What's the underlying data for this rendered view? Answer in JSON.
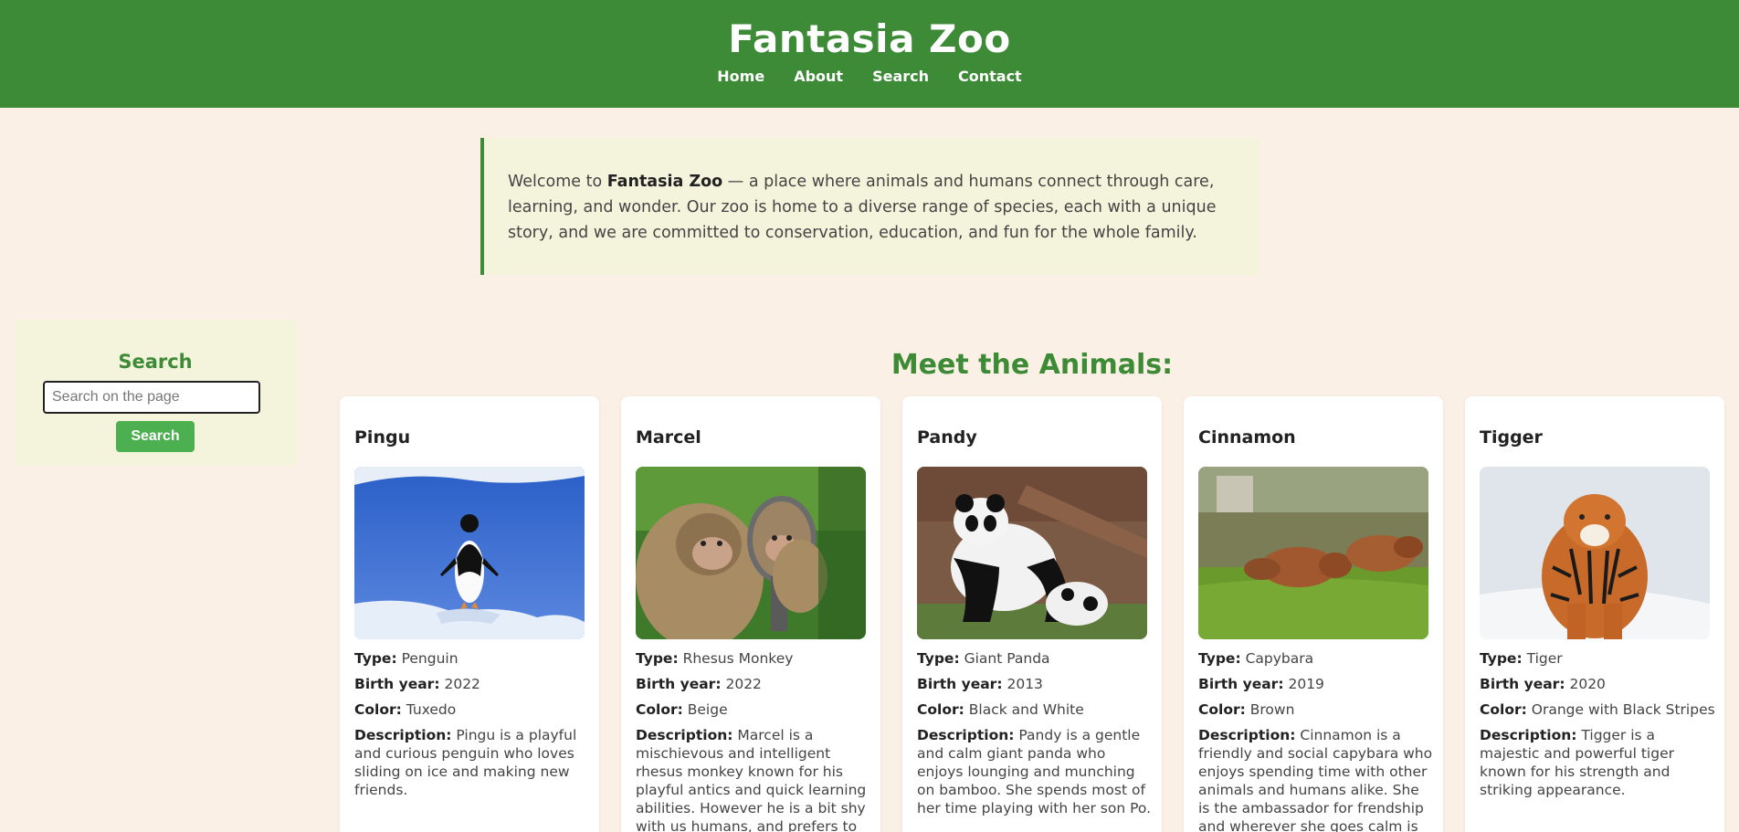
{
  "header": {
    "title": "Fantasia Zoo",
    "nav": [
      "Home",
      "About",
      "Search",
      "Contact"
    ]
  },
  "intro": {
    "lead": "Welcome to ",
    "bold": "Fantasia Zoo",
    "rest": " — a place where animals and humans connect through care, learning, and wonder. Our zoo is home to a diverse range of species, each with a unique story, and we are committed to conservation, education, and fun for the whole family."
  },
  "search": {
    "title": "Search",
    "placeholder": "Search on the page",
    "button": "Search"
  },
  "section_title": "Meet the Animals:",
  "labels": {
    "type": "Type:",
    "birth": "Birth year:",
    "color": "Color:",
    "description": "Description:"
  },
  "animals": [
    {
      "name": "Pingu",
      "type": "Penguin",
      "birth_year": "2022",
      "color": "Tuxedo",
      "description": "Pingu is a playful and curious penguin who loves sliding on ice and making new friends.",
      "image_icon": "penguin-photo"
    },
    {
      "name": "Marcel",
      "type": "Rhesus Monkey",
      "birth_year": "2022",
      "color": "Beige",
      "description": "Marcel is a mischievous and intelligent rhesus monkey known for his playful antics and quick learning abilities. However he is a bit shy with us humans, and prefers to look at us",
      "image_icon": "monkey-photo"
    },
    {
      "name": "Pandy",
      "type": "Giant Panda",
      "birth_year": "2013",
      "color": "Black and White",
      "description": "Pandy is a gentle and calm giant panda who enjoys lounging and munching on bamboo. She spends most of her time playing with her son Po.",
      "image_icon": "panda-photo"
    },
    {
      "name": "Cinnamon",
      "type": "Capybara",
      "birth_year": "2019",
      "color": "Brown",
      "description": "Cinnamon is a friendly and social capybara who enjoys spending time with other animals and humans alike. She is the ambassador for frendship and wherever she goes calm is",
      "image_icon": "capybara-photo"
    },
    {
      "name": "Tigger",
      "type": "Tiger",
      "birth_year": "2020",
      "color": "Orange with Black Stripes",
      "description": "Tigger is a majestic and powerful tiger known for his strength and striking appearance.",
      "image_icon": "tiger-photo"
    }
  ],
  "colors": {
    "header_green": "#3d8b37",
    "page_bg": "#fbf0e6",
    "panel_bg": "#f4f4dc",
    "button_green": "#4caf50"
  }
}
